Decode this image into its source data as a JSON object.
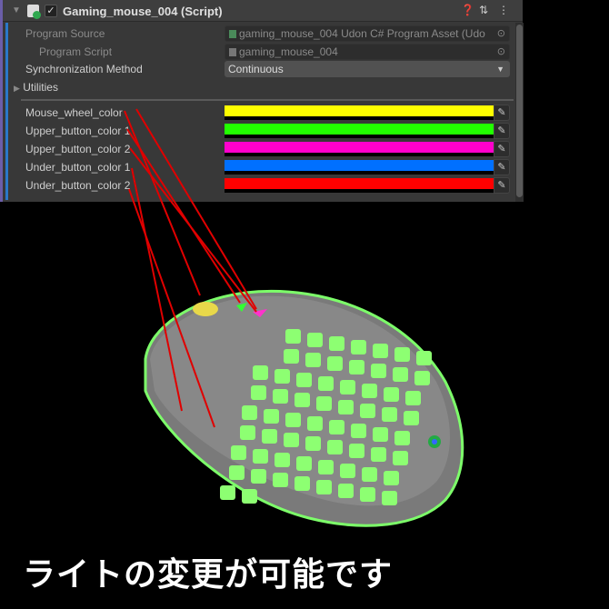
{
  "component": {
    "title": "Gaming_mouse_004 (Script)",
    "enabled": true,
    "icons": [
      "help-icon",
      "presets-icon",
      "more-icon"
    ]
  },
  "fields": {
    "program_source": {
      "label": "Program Source",
      "value": "gaming_mouse_004 Udon C# Program Asset (Udo"
    },
    "program_script": {
      "label": "Program Script",
      "value": "gaming_mouse_004"
    },
    "sync": {
      "label": "Synchronization Method",
      "value": "Continuous"
    },
    "utilities": {
      "label": "Utilities"
    }
  },
  "colors": [
    {
      "label": "Mouse_wheel_color",
      "color": "#ffff00"
    },
    {
      "label": "Upper_button_color 1",
      "color": "#22ff00"
    },
    {
      "label": "Upper_button_color 2",
      "color": "#ff00cc"
    },
    {
      "label": "Under_button_color 1",
      "color": "#0070ff"
    },
    {
      "label": "Under_button_color 2",
      "color": "#ff0000"
    }
  ],
  "caption": "ライトの変更が可能です"
}
